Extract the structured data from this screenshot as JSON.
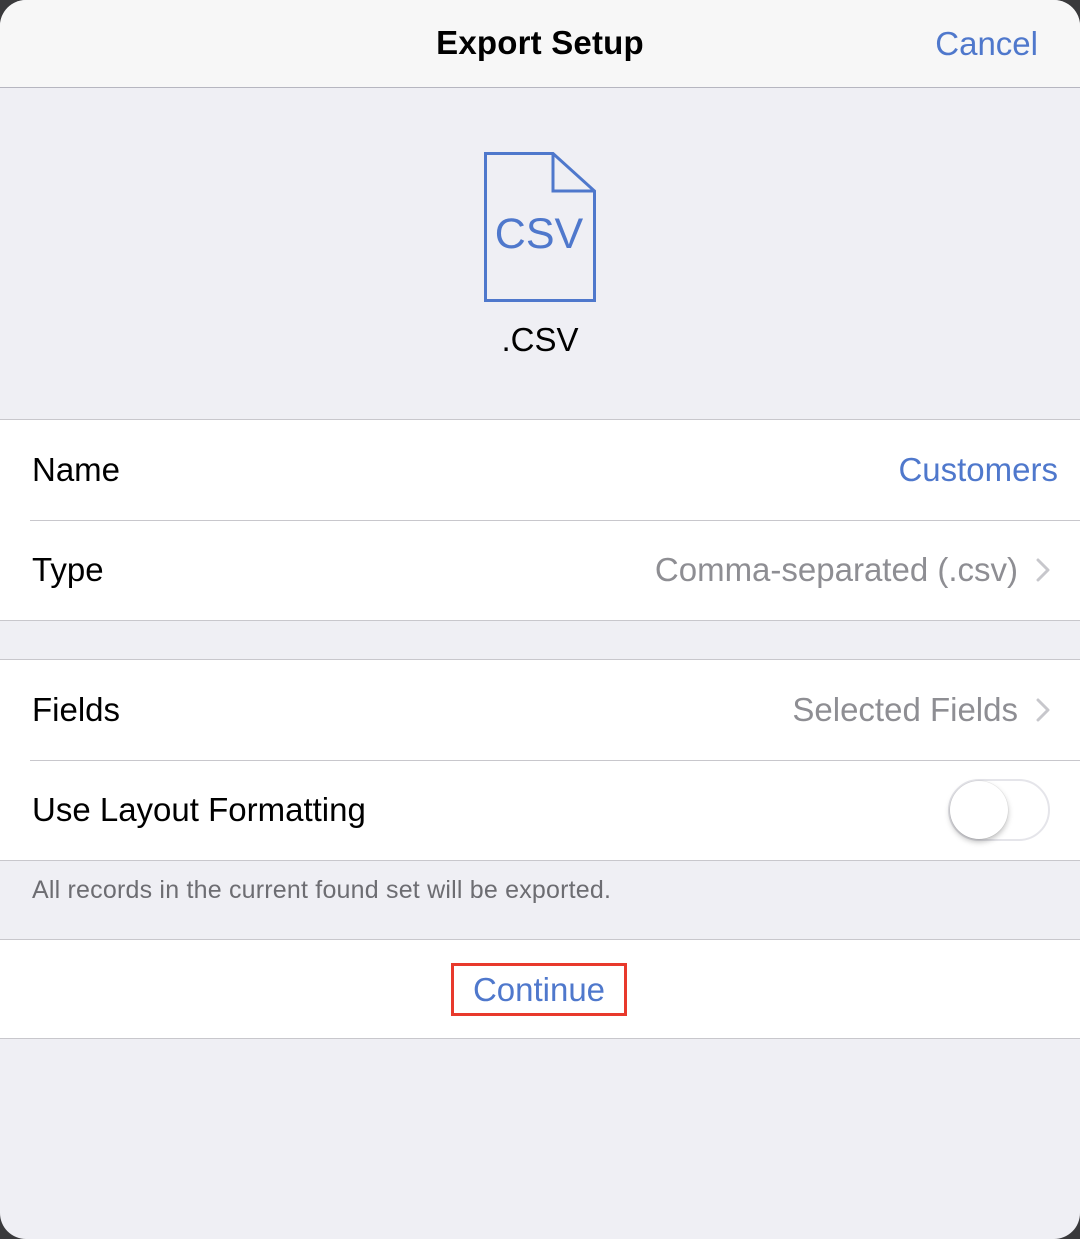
{
  "navbar": {
    "title": "Export Setup",
    "cancel_label": "Cancel"
  },
  "file": {
    "icon_text": "CSV",
    "extension": ".CSV",
    "icon_color": "#4f78cc"
  },
  "settings": {
    "name_label": "Name",
    "name_value": "Customers",
    "type_label": "Type",
    "type_value": "Comma-separated (.csv)",
    "fields_label": "Fields",
    "fields_value": "Selected Fields",
    "layout_label": "Use Layout Formatting",
    "layout_enabled": false
  },
  "footnote": "All records in the current found set will be exported.",
  "continue_label": "Continue",
  "colors": {
    "accent": "#4f78cc",
    "highlight": "#e8392c",
    "background": "#efeff4"
  }
}
